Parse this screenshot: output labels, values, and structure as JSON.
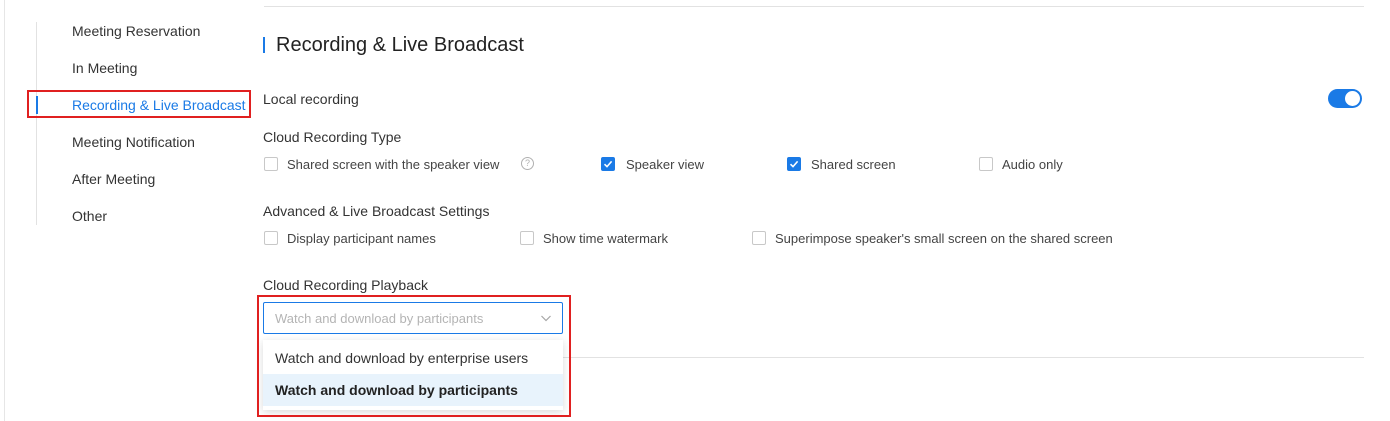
{
  "sidebar": {
    "items": [
      {
        "label": "Meeting Reservation"
      },
      {
        "label": "In Meeting"
      },
      {
        "label": "Recording & Live Broadcast"
      },
      {
        "label": "Meeting Notification"
      },
      {
        "label": "After Meeting"
      },
      {
        "label": "Other"
      }
    ],
    "active_index": 2
  },
  "section": {
    "title": "Recording & Live Broadcast"
  },
  "local_recording": {
    "label": "Local recording",
    "enabled": true
  },
  "cloud_recording_type": {
    "label": "Cloud Recording Type",
    "options": [
      {
        "label": "Shared screen with the speaker view",
        "checked": false
      },
      {
        "label": "Speaker view",
        "checked": true
      },
      {
        "label": "Shared screen",
        "checked": true
      },
      {
        "label": "Audio only",
        "checked": false
      }
    ],
    "help_icon": "question-circle-icon"
  },
  "advanced_settings": {
    "label": "Advanced & Live Broadcast Settings",
    "options": [
      {
        "label": "Display participant names",
        "checked": false
      },
      {
        "label": "Show time watermark",
        "checked": false
      },
      {
        "label": "Superimpose speaker's small screen on the shared screen",
        "checked": false
      }
    ]
  },
  "playback": {
    "label": "Cloud Recording Playback",
    "selected": "Watch and download by participants",
    "options": [
      {
        "label": "Watch and download by enterprise users"
      },
      {
        "label": "Watch and download by participants"
      }
    ]
  },
  "colors": {
    "accent": "#1a7ae6",
    "highlight_box": "#e02020",
    "selected_bg": "#e8f3fc"
  }
}
